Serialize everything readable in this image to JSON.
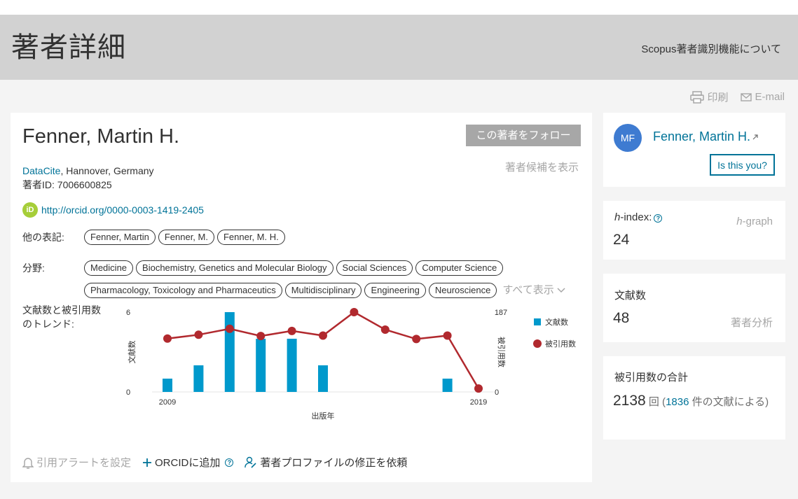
{
  "header": {
    "title": "著者詳細",
    "about": "Scopus著者識別機能について"
  },
  "actions": {
    "print": "印刷",
    "email": "E-mail"
  },
  "author": {
    "name": "Fenner, Martin H.",
    "follow": "この著者をフォロー",
    "candidates": "著者候補を表示",
    "affiliation_org": "DataCite",
    "affiliation_loc": ", Hannover, Germany",
    "author_id": "著者ID: 7006600825",
    "orcid_badge": "iD",
    "orcid_url": "http://orcid.org/0000-0003-1419-2405"
  },
  "aliases": {
    "label": "他の表記:",
    "items": [
      "Fenner, Martin",
      "Fenner, M.",
      "Fenner, M. H."
    ]
  },
  "fields": {
    "label": "分野:",
    "row1": [
      "Medicine",
      "Biochemistry, Genetics and Molecular Biology",
      "Social Sciences",
      "Computer Science"
    ],
    "row2": [
      "Pharmacology, Toxicology and Pharmaceutics",
      "Multidisciplinary",
      "Engineering",
      "Neuroscience"
    ],
    "show_all": "すべて表示"
  },
  "trend": {
    "label": "文献数と被引用数のトレンド:"
  },
  "chart_data": {
    "type": "bar",
    "x": [
      2009,
      2010,
      2011,
      2012,
      2013,
      2014,
      2015,
      2016,
      2017,
      2018,
      2019
    ],
    "x_tick_labels": [
      "2009",
      "2019"
    ],
    "xlabel": "出版年",
    "ylabel_left": "文献数",
    "ylabel_right": "被引用数",
    "ylim_left": [
      0,
      6
    ],
    "ylim_right": [
      0,
      187
    ],
    "left_ticks": [
      "6",
      "0"
    ],
    "right_ticks": [
      "187",
      "0"
    ],
    "series": [
      {
        "name": "文献数",
        "kind": "bar",
        "color": "#0099cc",
        "values": [
          1,
          2,
          6,
          4,
          4,
          2,
          0,
          0,
          0,
          1,
          0
        ]
      },
      {
        "name": "被引用数",
        "kind": "line",
        "color": "#b1292e",
        "values": [
          125,
          134,
          148,
          131,
          143,
          132,
          187,
          146,
          124,
          132,
          8
        ]
      }
    ],
    "legend": "right"
  },
  "bottom_actions": {
    "alert": "引用アラートを設定",
    "orcid": "ORCIDに追加",
    "profile": "著者プロファイルの修正を依頼"
  },
  "side": {
    "initials": "MF",
    "name": "Fenner, Martin H.",
    "is_you": "Is this you?",
    "hindex_label": "-index:",
    "hindex_h": "h",
    "hindex_value": "24",
    "hgraph": "-graph",
    "docs_label": "文献数",
    "docs_value": "48",
    "analyze": "著者分析",
    "cites_label": "被引用数の合計",
    "cites_value": "2138",
    "cites_unit": " 回 (",
    "cites_docs": "1836",
    "cites_suffix": " 件の文献による)"
  }
}
